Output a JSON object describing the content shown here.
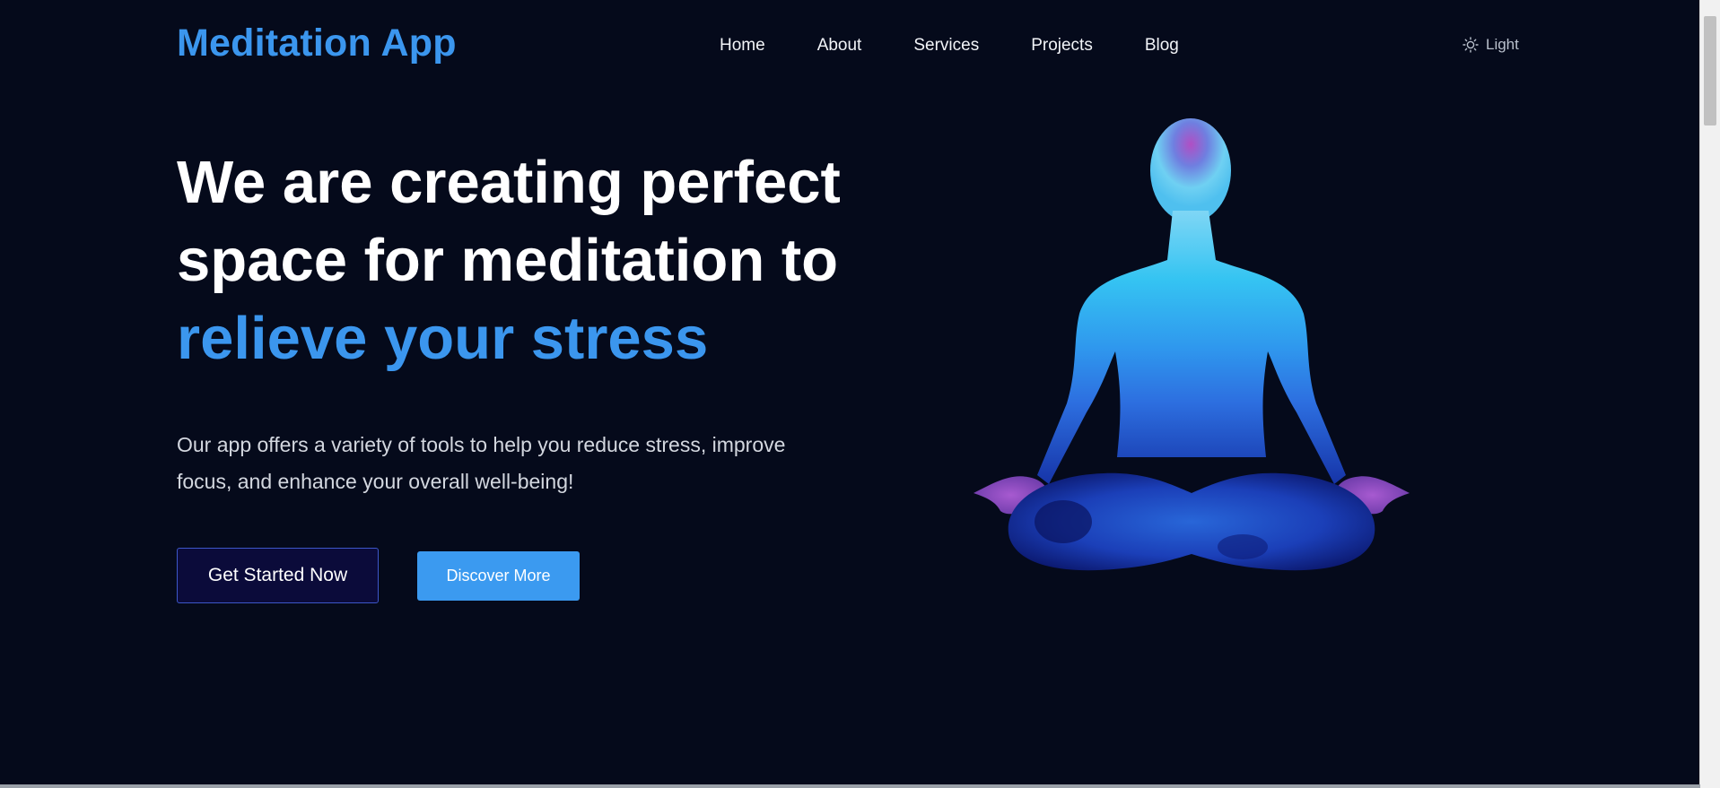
{
  "header": {
    "logo": "Meditation App",
    "nav": [
      "Home",
      "About",
      "Services",
      "Projects",
      "Blog"
    ],
    "theme_toggle": {
      "label": "Light",
      "icon": "sun-icon"
    }
  },
  "hero": {
    "headline_line1": "We are creating perfect",
    "headline_line2": "space for meditation to",
    "headline_accent": "relieve your stress",
    "subtext": "Our app offers a variety of tools to help you reduce stress, improve focus, and enhance your overall well-being!",
    "primary_button": "Get Started Now",
    "secondary_button": "Discover More",
    "illustration": "meditating-figure-illustration"
  },
  "colors": {
    "background": "#050a1b",
    "accent": "#3b96ee",
    "primary_button_bg": "#0b0b3a",
    "secondary_button_bg": "#3b9af0"
  }
}
